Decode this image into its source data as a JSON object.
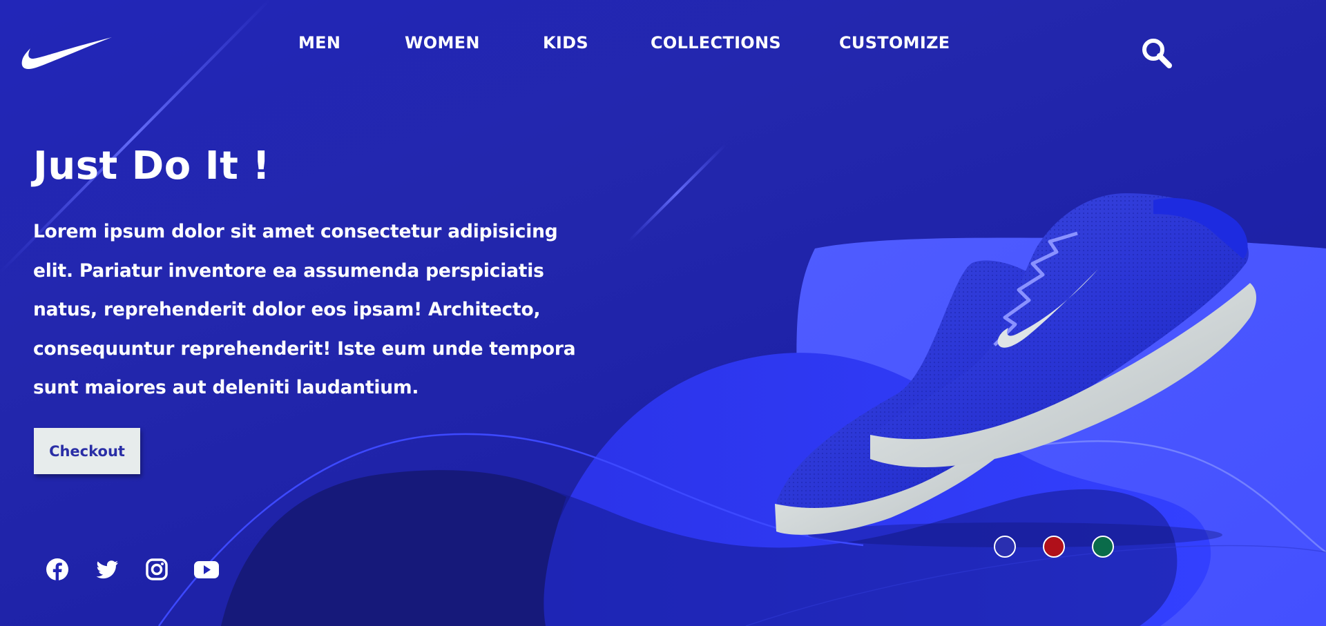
{
  "brand": {
    "logo_icon": "swoosh-logo-icon"
  },
  "nav": {
    "items": [
      {
        "label": "MEN"
      },
      {
        "label": "WOMEN"
      },
      {
        "label": "KIDS"
      },
      {
        "label": "COLLECTIONS"
      },
      {
        "label": "CUSTOMIZE"
      }
    ],
    "search_icon": "search-icon"
  },
  "hero": {
    "title": "Just Do It !",
    "description": "Lorem ipsum dolor sit amet consectetur adipisicing elit. Pariatur inventore ea assumenda perspiciatis natus, reprehenderit dolor eos ipsam! Architecto, consequuntur reprehenderit! Iste eum unde tempora sunt maiores aut deleniti laudantium.",
    "cta_label": "Checkout"
  },
  "social": {
    "icons": [
      "facebook-icon",
      "twitter-icon",
      "instagram-icon",
      "youtube-icon"
    ]
  },
  "product": {
    "image_icon": "sneaker-product-image",
    "color_options": [
      "#2a2fb0",
      "#b0101a",
      "#0a6b4a"
    ]
  },
  "colors": {
    "background": "#2226b8",
    "wave_light": "#4a55ff",
    "wave_mid": "#2f3af0",
    "wave_dark": "#15177a",
    "button_bg": "#e7ecec",
    "button_text": "#2a2ea6",
    "text": "#ffffff"
  }
}
